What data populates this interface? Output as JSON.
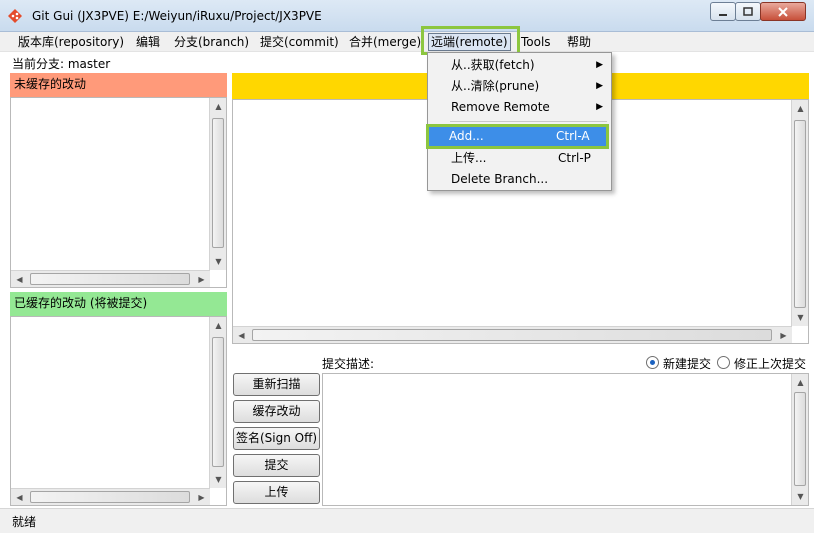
{
  "window": {
    "title": "Git Gui (JX3PVE) E:/Weiyun/iRuxu/Project/JX3PVE"
  },
  "menubar": {
    "items": [
      "版本库(repository)",
      "编辑",
      "分支(branch)",
      "提交(commit)",
      "合并(merge)",
      "远端(remote)",
      "Tools",
      "帮助"
    ],
    "active": "远端(remote)"
  },
  "branch": {
    "label": "当前分支: master"
  },
  "unstaged": {
    "header": "未缓存的改动"
  },
  "staged": {
    "header": "已缓存的改动 (将被提交)"
  },
  "commit": {
    "label": "提交描述:",
    "radio_new": "新建提交",
    "radio_amend": "修正上次提交",
    "buttons": [
      "重新扫描",
      "缓存改动",
      "签名(Sign Off)",
      "提交",
      "上传"
    ]
  },
  "status": {
    "text": "就绪"
  },
  "remote_menu": {
    "items": [
      {
        "label": "从..获取(fetch)",
        "accel": "",
        "submenu": true
      },
      {
        "label": "从..清除(prune)",
        "accel": "",
        "submenu": true
      },
      {
        "label": "Remove Remote",
        "accel": "",
        "submenu": true
      },
      {
        "label": "Add...",
        "accel": "Ctrl-A",
        "submenu": false
      },
      {
        "label": "上传...",
        "accel": "Ctrl-P",
        "submenu": false
      },
      {
        "label": "Delete Branch...",
        "accel": "",
        "submenu": false
      }
    ],
    "selected": "Add..."
  },
  "colors": {
    "unstaged_header": "#ff9a7a",
    "staged_header": "#94e894",
    "diff_header": "#ffd700",
    "menu_selection": "#3d8ee8",
    "annotation_outline": "#8cc63f"
  }
}
